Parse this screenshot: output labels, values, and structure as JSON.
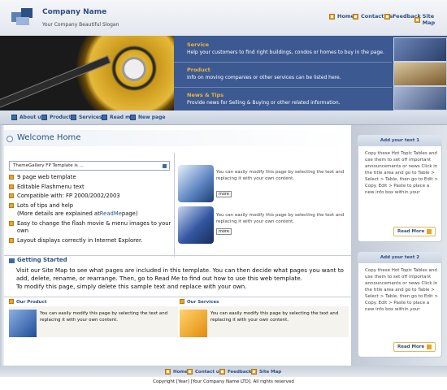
{
  "header": {
    "company_name": "Company Name",
    "slogan": "Your Company Beautiful Slogan",
    "links": [
      "Home",
      "Contact us",
      "Feedback",
      "Site Map"
    ]
  },
  "banner": {
    "sections": [
      {
        "title": "Service",
        "text": "Help your customers to find right buildings, condos or homes to buy in the page."
      },
      {
        "title": "Product",
        "text": "Info on moving companies or other services can be listed here."
      },
      {
        "title": "News & Tips",
        "text": "Provide news for Selling & Buying or other related information."
      }
    ]
  },
  "nav": {
    "items": [
      "About us",
      "Product",
      "Services",
      "Read me",
      "New page"
    ]
  },
  "welcome": {
    "title": "Welcome Home",
    "dropdown_text": "ThemeGallery FP Template is ...",
    "features": [
      "9 page web template",
      "Editable Flashmenu text",
      "Compatible with: FP 2000/2002/2003",
      "Lots of tips and help",
      "Easy to change the flash movie & menu images to your own",
      "Layout displays correctly in Internet Explorer."
    ],
    "details_prefix": "(More details are explained at ",
    "details_link": "ReadMe",
    "details_suffix": " page)",
    "thumb_text_1": "You can easily modify this page by selecting the text and replacing it with your own content.",
    "thumb_text_2": "You can easily modify this page by selecting the text and replacing it with your own content.",
    "more_label": "more"
  },
  "getting_started": {
    "title": "Getting Started",
    "text_1": "Visit our Site Map to see what pages are included in this template. You can then decide what pages you want to add, delete, rename, or rearrange. Then, go to Read Me to find out how to use this web template.",
    "text_2": "To modify this page, simply delete this sample text and replace with your own."
  },
  "products": {
    "our_product_title": "Our Product",
    "our_product_text": "You can easily modify this page by selecting the text and replacing it with your own content.",
    "our_services_title": "Our Services",
    "our_services_text": "You can easily modify this page by selecting the text and replacing it with your own content."
  },
  "sidebar": {
    "box1_title": "Add your text 1",
    "box1_text": "Copy these Hot Topic Tables and use them to set off important announcements or news Click in the title area and go to Table > Select > Table, then go to Edit > Copy. Edit > Paste to place a new info box within your",
    "box2_title": "Add your text 2",
    "box2_text": "Copy these Hot Topic Tables and use them to set off important announcements or news Click in the title area and go to Table > Select > Table, then go to Edit > Copy. Edit > Paste to place a new info box within your",
    "read_more": "Read More"
  },
  "footer": {
    "links": [
      "Home",
      "Contact us",
      "Feedback",
      "Site Map"
    ],
    "copyright": "Copyright [Year] [Your Company Name LTD]. All rights reserved"
  },
  "colors": {
    "brand_blue": "#2c4f86",
    "accent_orange": "#e7a629",
    "banner_blue": "#3c5a91"
  }
}
